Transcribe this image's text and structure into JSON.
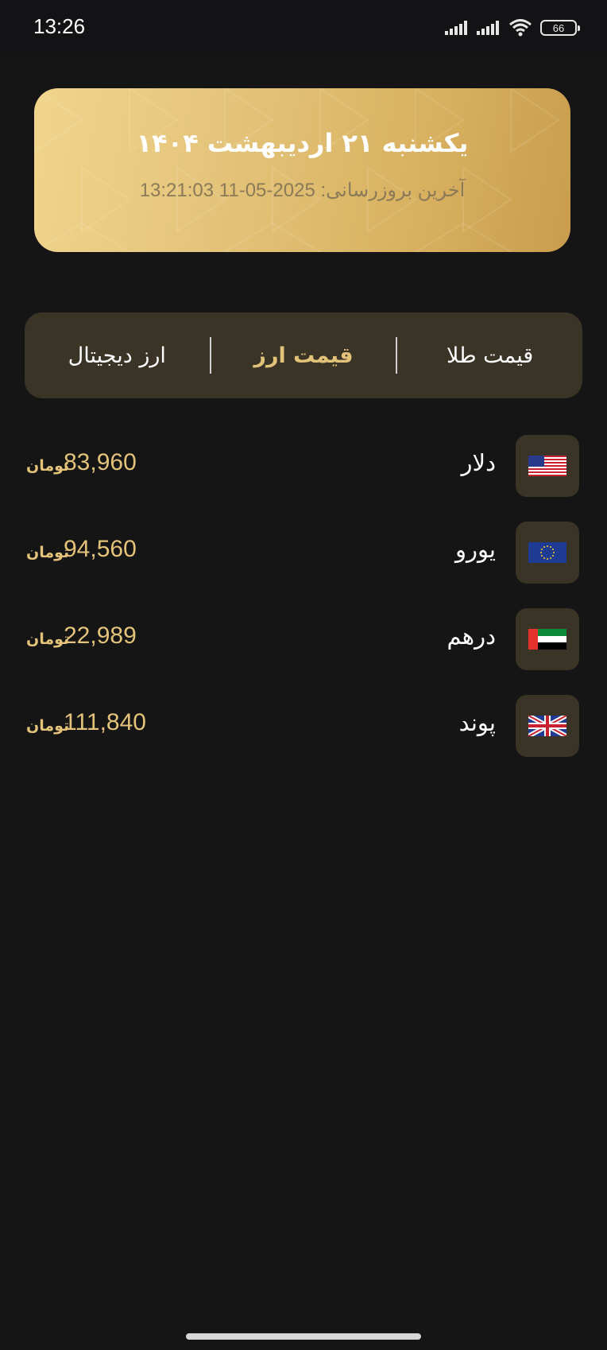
{
  "status_bar": {
    "time": "13:26",
    "battery": "66"
  },
  "header": {
    "date": "یکشنبه ۲۱ اردیبهشت ۱۴۰۴",
    "last_update": "آخرین بروزرسانی: 2025-05-11 13:21:03"
  },
  "tabs": [
    {
      "label": "قیمت طلا",
      "active": false
    },
    {
      "label": "قیمت ارز",
      "active": true
    },
    {
      "label": "ارز دیجیتال",
      "active": false
    }
  ],
  "rates": [
    {
      "name": "دلار",
      "price": "83,960",
      "unit": "تومان",
      "flag": "us-flag-icon"
    },
    {
      "name": "یورو",
      "price": "94,560",
      "unit": "تومان",
      "flag": "eu-flag-icon"
    },
    {
      "name": "درهم",
      "price": "22,989",
      "unit": "تومان",
      "flag": "uae-flag-icon"
    },
    {
      "name": "پوند",
      "price": "111,840",
      "unit": "تومان",
      "flag": "uk-flag-icon"
    }
  ],
  "colors": {
    "accent": "#e3c27a",
    "background": "#151515",
    "card": "#3a3426"
  }
}
